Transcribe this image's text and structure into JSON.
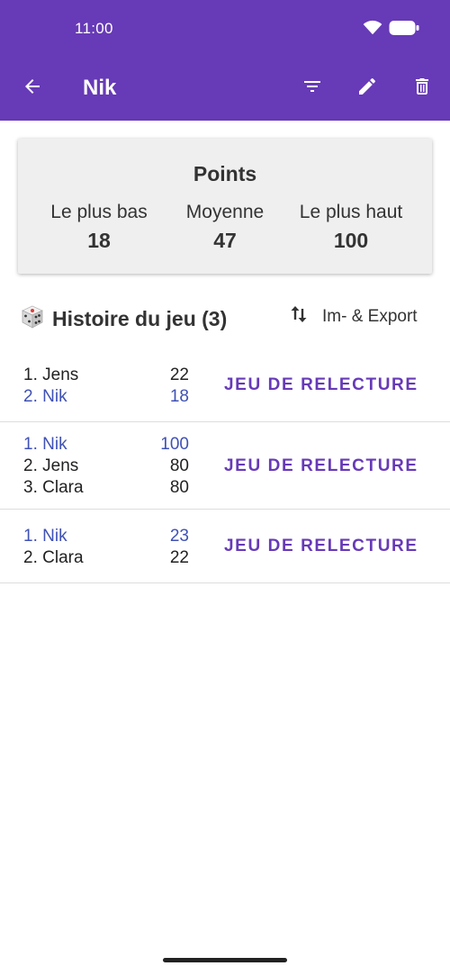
{
  "status": {
    "time": "11:00"
  },
  "toolbar": {
    "title": "Nik"
  },
  "points": {
    "title": "Points",
    "stats": [
      {
        "label": "Le plus bas",
        "value": "18"
      },
      {
        "label": "Moyenne",
        "value": "47"
      },
      {
        "label": "Le plus haut",
        "value": "100"
      }
    ]
  },
  "history": {
    "title": "Histoire du jeu (3)",
    "export_label": "Im- & Export",
    "replay_label": "JEU DE RELECTURE",
    "games": [
      {
        "rows": [
          {
            "name": "1. Jens",
            "score": "22"
          },
          {
            "name": "2. Nik",
            "score": "18"
          }
        ]
      },
      {
        "rows": [
          {
            "name": "1. Nik",
            "score": "100"
          },
          {
            "name": "2. Jens",
            "score": "80"
          },
          {
            "name": "3. Clara",
            "score": "80"
          }
        ]
      },
      {
        "rows": [
          {
            "name": "1. Nik",
            "score": "23"
          },
          {
            "name": "2. Clara",
            "score": "22"
          }
        ]
      }
    ]
  },
  "colors": {
    "primary": "#673ab7",
    "highlight": "#3f51b5",
    "card_bg": "#efefef"
  },
  "icons": [
    "wifi-icon",
    "battery-icon",
    "back-arrow-icon",
    "filter-icon",
    "edit-icon",
    "delete-icon",
    "dice-icon",
    "sort-icon"
  ]
}
